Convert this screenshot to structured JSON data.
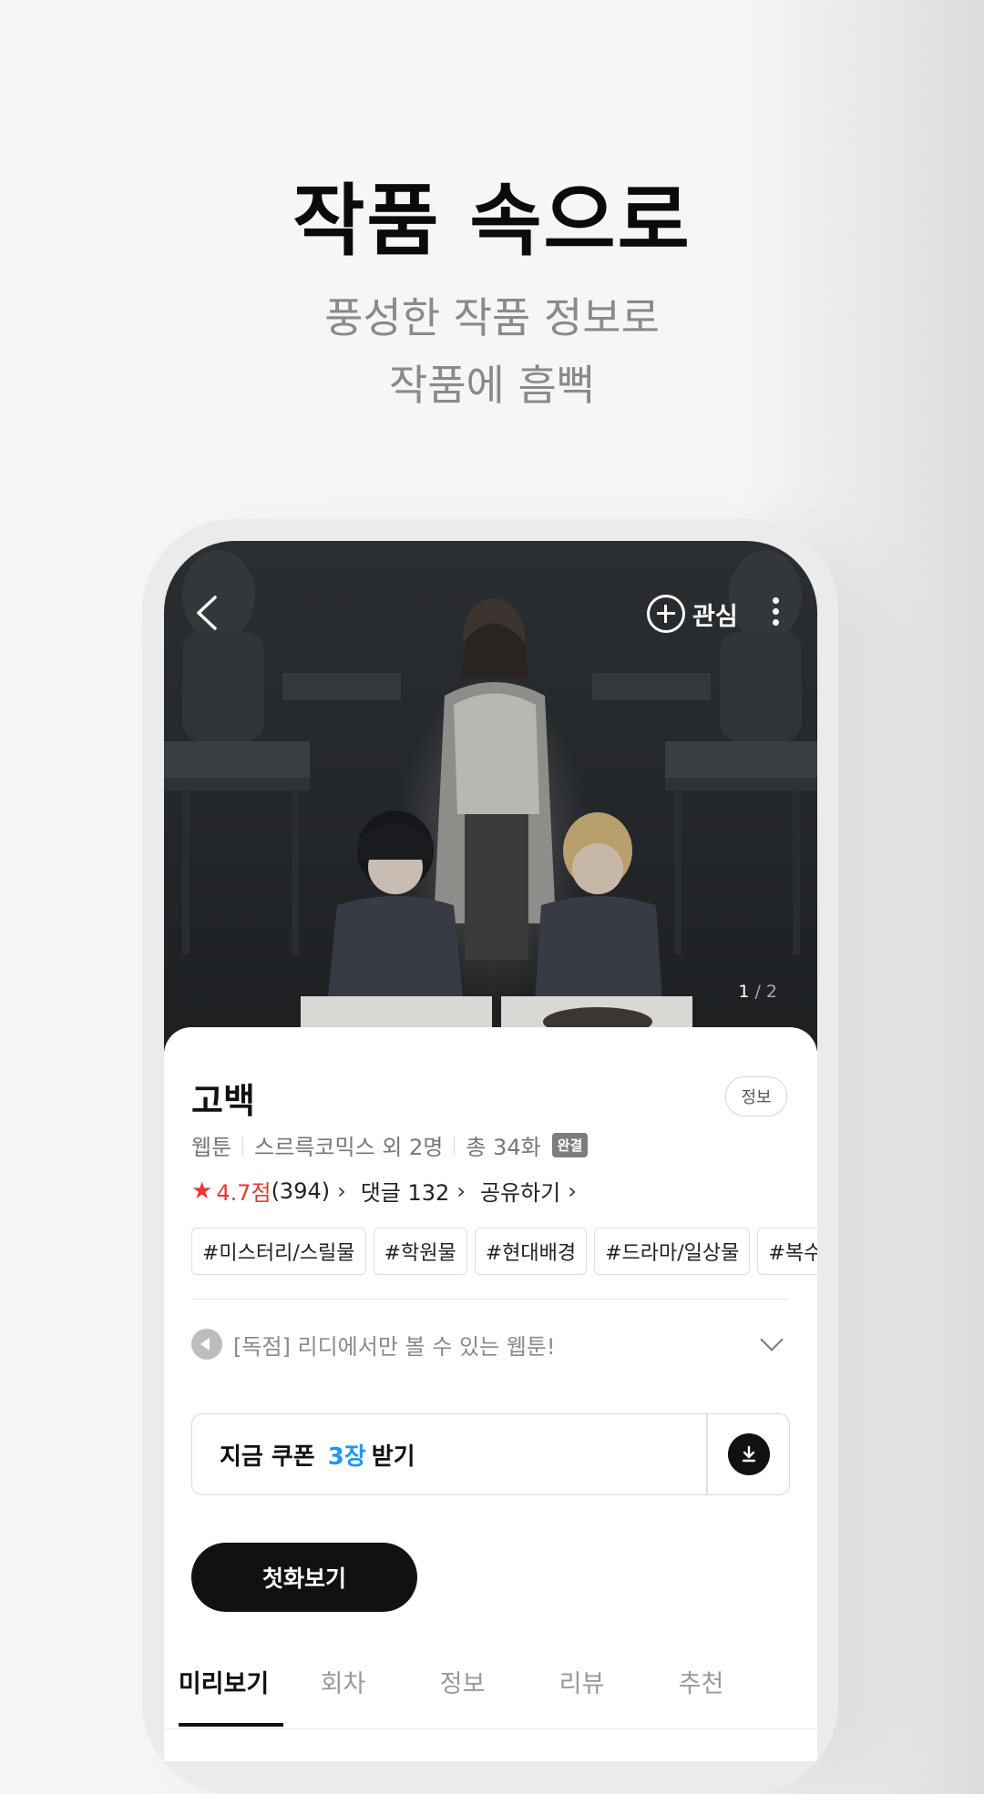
{
  "promo": {
    "title": "작품 속으로",
    "subtitle_line1": "풍성한 작품 정보로",
    "subtitle_line2": "작품에 흠뻑"
  },
  "top_bar": {
    "back_icon": "chevron-left-icon",
    "favorite_label": "관심",
    "more_icon": "more-vertical-icon"
  },
  "cover": {
    "page_current": "1",
    "page_separator": "/",
    "page_total": "2"
  },
  "work": {
    "title": "고백",
    "info_button": "정보",
    "type": "웹툰",
    "authors": "스르륵코믹스 외 2명",
    "episodes": "총 34화",
    "status_badge": "완결",
    "rating": "4.7점",
    "rating_count": "(394)",
    "comments": "댓글 132",
    "share": "공유하기",
    "tags": [
      "#미스터리/스릴물",
      "#학원물",
      "#현대배경",
      "#드라마/일상물",
      "#복수"
    ]
  },
  "notice": {
    "text": "[독점] 리디에서만 볼 수 있는 웹툰!"
  },
  "coupon": {
    "prefix": "지금 쿠폰",
    "count": "3장",
    "suffix": "받기"
  },
  "actions": {
    "first_episode": "첫화보기"
  },
  "tabs": [
    "미리보기",
    "회차",
    "정보",
    "리뷰",
    "추천"
  ],
  "colors": {
    "accent_red": "#e53935",
    "accent_blue": "#2196f3",
    "primary_black": "#111111"
  }
}
